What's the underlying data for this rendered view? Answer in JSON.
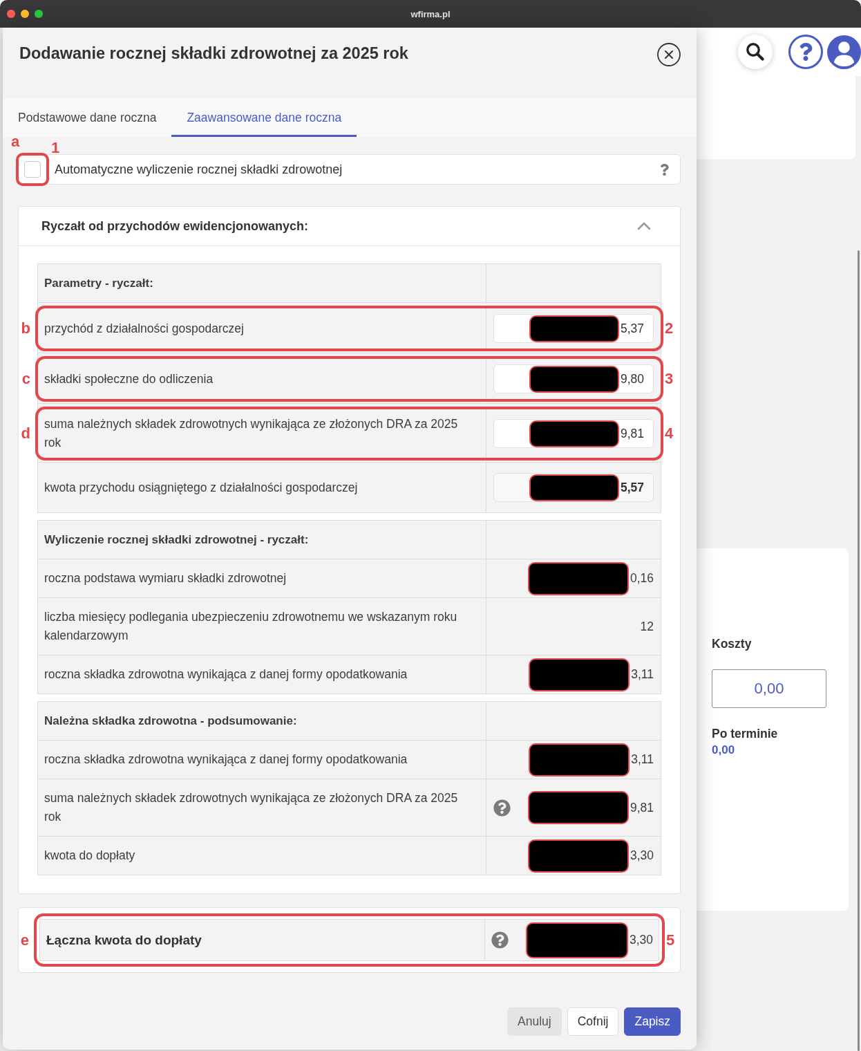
{
  "window": {
    "title": "wfirma.pl"
  },
  "background_app": {
    "costs": {
      "label": "Koszty",
      "value": "0,00"
    },
    "overdue": {
      "label": "Po terminie",
      "value": "0,00"
    }
  },
  "dialog": {
    "title": "Dodawanie rocznej składki zdrowotnej za 2025 rok",
    "tabs": [
      {
        "label": "Podstawowe dane roczna",
        "selected": false
      },
      {
        "label": "Zaawansowane dane roczna",
        "selected": true
      }
    ],
    "auto_calculation": {
      "label": "Automatyczne wyliczenie rocznej składki zdrowotnej",
      "checked": false,
      "help": true,
      "annotation": {
        "letter": "a",
        "number": "1"
      }
    },
    "section": {
      "title": "Ryczałt od przychodów ewidencjonowanych:",
      "expanded": true,
      "tables": [
        {
          "heading": "Parametry - ryczałt:",
          "rows": [
            {
              "label": "przychód z działalności gospodarczej",
              "kind": "input",
              "value": "5,37",
              "redacted": true,
              "help": false,
              "annotation": {
                "letter": "b",
                "number": "2"
              }
            },
            {
              "label": "składki społeczne do odliczenia",
              "kind": "input",
              "value": "9,80",
              "redacted": true,
              "help": false,
              "annotation": {
                "letter": "c",
                "number": "3"
              }
            },
            {
              "label": "suma należnych składek zdrowotnych wynikająca ze złożonych DRA za 2025 rok",
              "kind": "input",
              "value": "9,81",
              "redacted": true,
              "help": false,
              "annotation": {
                "letter": "d",
                "number": "4"
              }
            },
            {
              "label": "kwota przychodu osiągniętego z działalności gospodarczej",
              "kind": "readonly",
              "value": "5,57",
              "redacted": true,
              "help": false
            }
          ]
        },
        {
          "heading": "Wyliczenie rocznej składki zdrowotnej - ryczałt:",
          "rows": [
            {
              "label": "roczna podstawa wymiaru składki zdrowotnej",
              "kind": "text",
              "value": "0,16",
              "redacted": true,
              "help": false
            },
            {
              "label": "liczba miesięcy podlegania ubezpieczeniu zdrowotnemu we wskazanym roku kalendarzowym",
              "kind": "text",
              "value": "12",
              "redacted": false,
              "help": false
            },
            {
              "label": "roczna składka zdrowotna wynikająca z danej formy opodatkowania",
              "kind": "text",
              "value": "3,11",
              "redacted": true,
              "help": false
            }
          ]
        },
        {
          "heading": "Należna składka zdrowotna - podsumowanie:",
          "rows": [
            {
              "label": "roczna składka zdrowotna wynikająca z danej formy opodatkowania",
              "kind": "text",
              "value": "3,11",
              "redacted": true,
              "help": false
            },
            {
              "label": "suma należnych składek zdrowotnych wynikająca ze złożonych DRA za 2025 rok",
              "kind": "text",
              "value": "9,81",
              "redacted": true,
              "help": true
            },
            {
              "label": "kwota do dopłaty",
              "kind": "text",
              "value": "3,30",
              "redacted": true,
              "help": false
            }
          ]
        }
      ]
    },
    "total": {
      "label": "Łączna kwota do dopłaty",
      "value": "3,30",
      "redacted": true,
      "help": true,
      "annotation": {
        "letter": "e",
        "number": "5"
      }
    },
    "buttons": [
      {
        "label": "Anuluj",
        "kind": "cancel"
      },
      {
        "label": "Cofnij",
        "kind": "back"
      },
      {
        "label": "Zapisz",
        "kind": "save"
      }
    ]
  }
}
